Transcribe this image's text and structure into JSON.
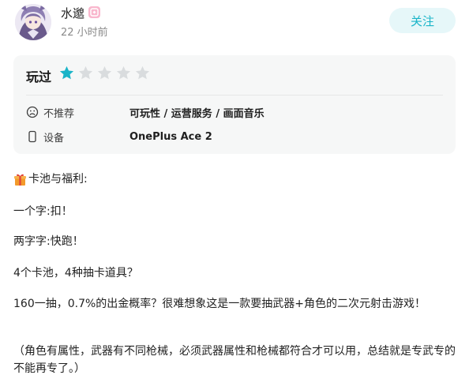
{
  "user": {
    "name": "水邈",
    "time": "22 小时前",
    "follow_label": "关注"
  },
  "review": {
    "played_label": "玩过",
    "rating": 1,
    "max_rating": 5,
    "rows": [
      {
        "icon": "frown-face-icon",
        "label": "不推荐",
        "value": "可玩性 / 运营服务 / 画面音乐"
      },
      {
        "icon": "phone-icon",
        "label": "设备",
        "value": "OnePlus Ace 2"
      }
    ]
  },
  "content": {
    "heading": "卡池与福利:",
    "lines": [
      "一个字:扣！",
      "两字字:快跑！",
      "4个卡池，4种抽卡道具？",
      "160一抽，0.7%的出金概率？很难想象这是一款要抽武器+角色的二次元射击游戏！",
      "（角色有属性，武器有不同枪械，必须武器属性和枪械都符合才可以用，总结就是专武专的不能再专了。）"
    ]
  },
  "colors": {
    "accent": "#19b4c8",
    "star_filled": "#19b4c8",
    "star_empty": "#d9dcde",
    "follow_bg": "#e6f7f9"
  }
}
